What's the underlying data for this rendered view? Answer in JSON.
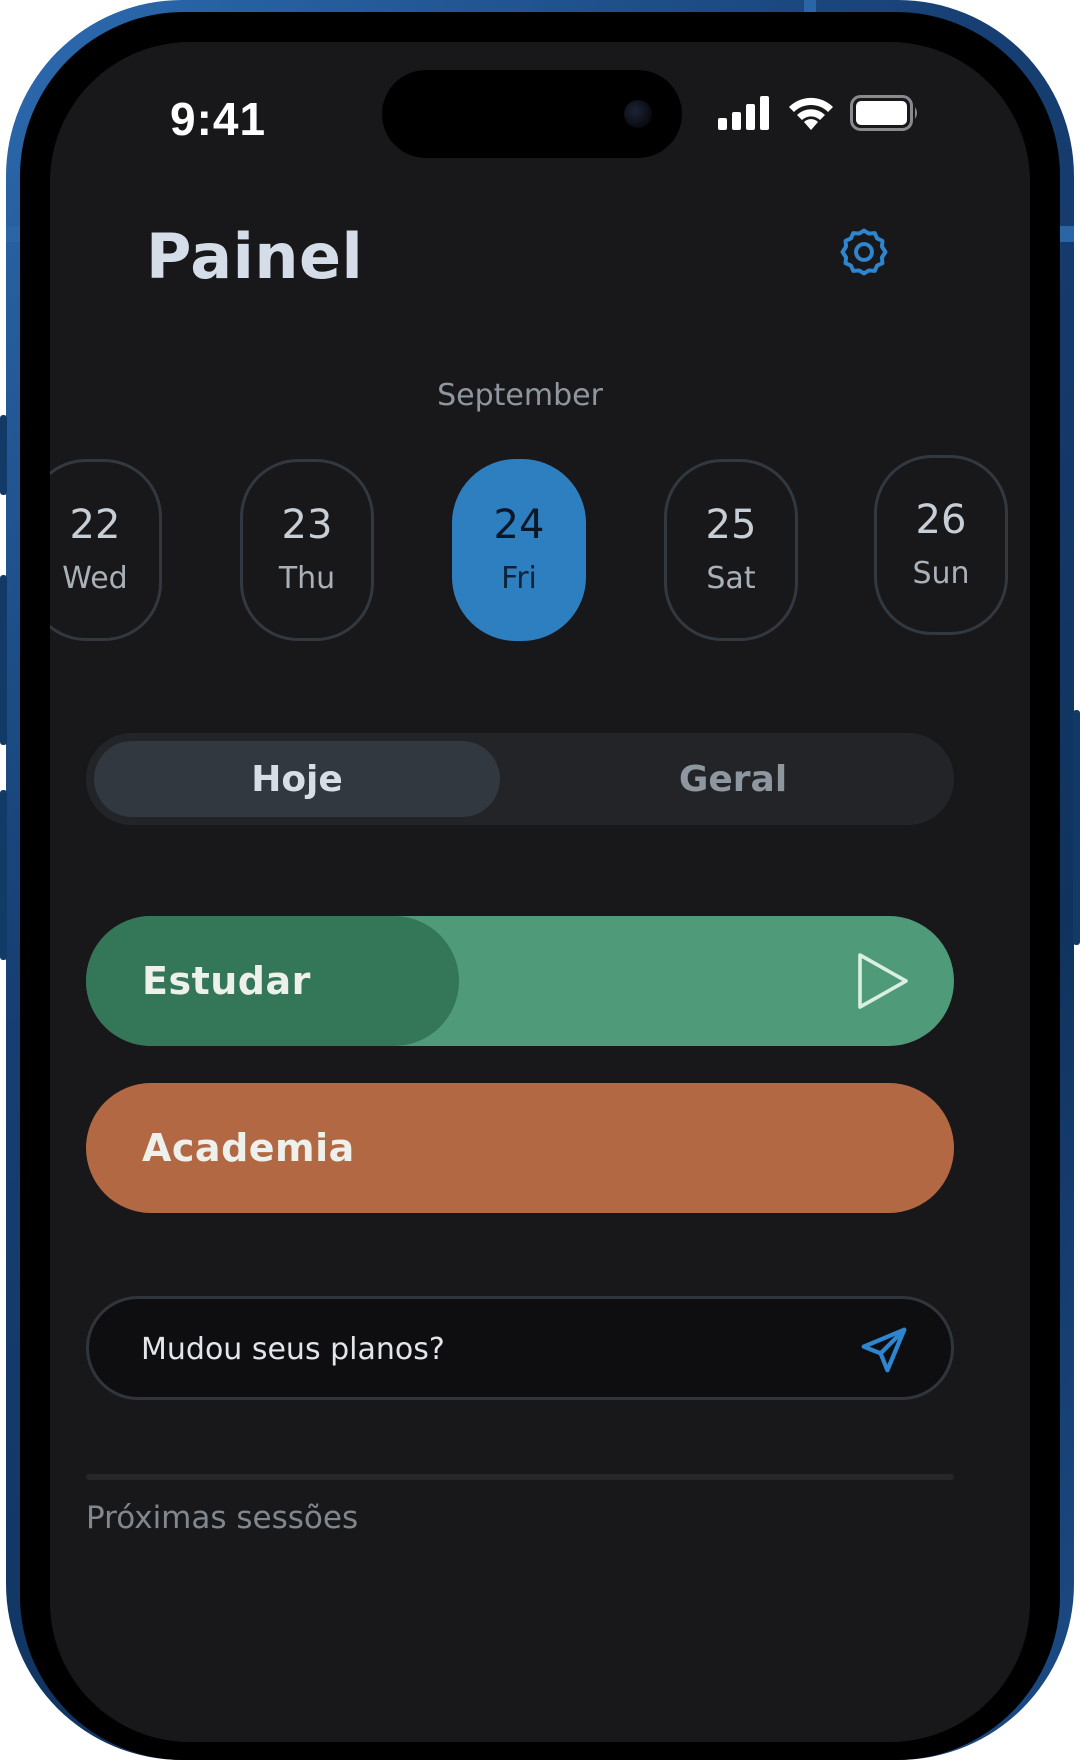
{
  "status_bar": {
    "time": "9:41",
    "signal_icon": "cellular-signal-icon",
    "wifi_icon": "wifi-icon",
    "battery_icon": "battery-icon"
  },
  "header": {
    "title": "Painel",
    "settings_icon": "gear-icon"
  },
  "calendar": {
    "month": "September",
    "days": [
      {
        "num": "22",
        "name": "Wed",
        "selected": false
      },
      {
        "num": "23",
        "name": "Thu",
        "selected": false
      },
      {
        "num": "24",
        "name": "Fri",
        "selected": true
      },
      {
        "num": "25",
        "name": "Sat",
        "selected": false
      },
      {
        "num": "26",
        "name": "Sun",
        "selected": false
      }
    ]
  },
  "tabs": {
    "today_label": "Hoje",
    "general_label": "Geral",
    "active": "Hoje"
  },
  "activities": [
    {
      "label": "Estudar",
      "progress": 0.43,
      "color_base": "#4f9a78",
      "color_fill": "#347658",
      "icon": "play-icon"
    },
    {
      "label": "Academia",
      "progress": 0.0,
      "color_base": "#b36844",
      "color_fill": "#b36844",
      "icon": ""
    }
  ],
  "message": {
    "placeholder": "Mudou seus planos?",
    "send_icon": "send-icon"
  },
  "upcoming": {
    "title": "Próximas sessões"
  },
  "colors": {
    "accent": "#2d7fbf",
    "background": "#18181a"
  }
}
